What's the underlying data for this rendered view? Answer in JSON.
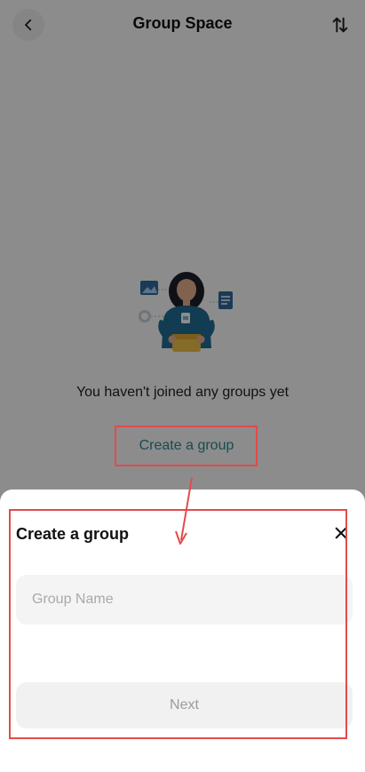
{
  "header": {
    "title": "Group Space"
  },
  "empty_state": {
    "message": "You haven't joined any groups yet",
    "create_link": "Create a group"
  },
  "sheet": {
    "title": "Create a group",
    "name_placeholder": "Group Name",
    "next_label": "Next"
  },
  "icons": {
    "back": "chevron-left-icon",
    "sort": "sort-arrows-icon",
    "close": "close-icon"
  },
  "colors": {
    "accent": "#2a8a93",
    "annotation": "#e44a4a"
  }
}
